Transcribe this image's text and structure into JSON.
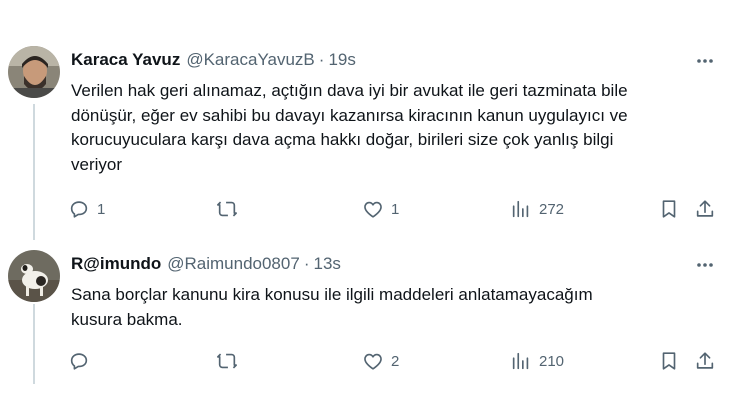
{
  "tweets": [
    {
      "display_name": "Karaca Yavuz",
      "handle": "@KaracaYavuzB",
      "separator": "·",
      "time": "19s",
      "text_lines": [
        "Verilen hak geri alınamaz, açtığın dava iyi bir avukat ile geri tazminata bile",
        "dönüşür, eğer ev sahibi bu davayı kazanırsa kiracının kanun uygulayıcı ve",
        "korucuyuculara karşı dava açma hakkı doğar, birileri size çok yanlış bilgi",
        "veriyor"
      ],
      "replies": "1",
      "retweets": "",
      "likes": "1",
      "views": "272"
    },
    {
      "display_name": "R@imundo",
      "handle": "@Raimundo0807",
      "separator": "·",
      "time": "13s",
      "text_lines": [
        "Sana borçlar kanunu kira konusu ile ilgili maddeleri anlatamayacağım",
        "kusura bakma."
      ],
      "replies": "",
      "retweets": "",
      "likes": "2",
      "views": "210"
    }
  ],
  "icons": {
    "reply": "reply-icon",
    "retweet": "retweet-icon",
    "like": "heart-icon",
    "views": "views-icon",
    "bookmark": "bookmark-icon",
    "share": "share-icon",
    "more": "more-icon"
  },
  "colors": {
    "text": "#0f1419",
    "muted": "#536471",
    "thread_line": "#cfd9de"
  }
}
